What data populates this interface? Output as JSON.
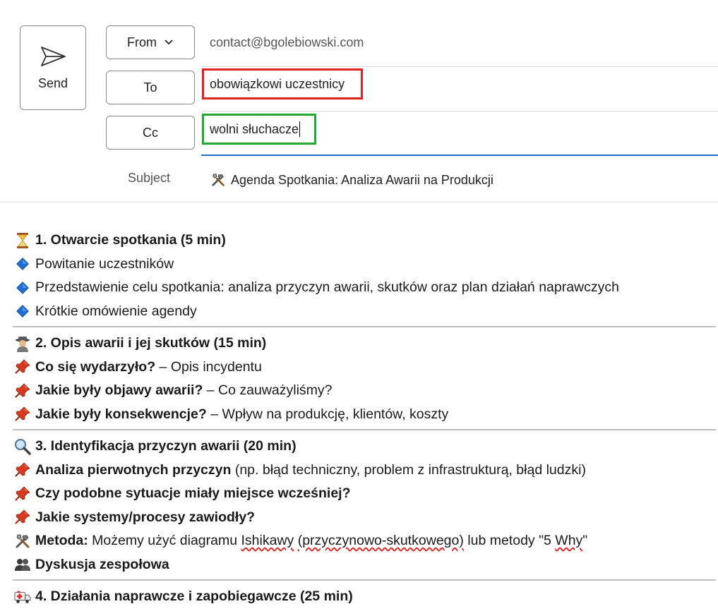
{
  "header": {
    "send_label": "Send",
    "from_label": "From",
    "from_value": "contact@bgolebiowski.com",
    "to_label": "To",
    "to_value": "obowiązkowi uczestnicy",
    "cc_label": "Cc",
    "cc_value": "wolni słuchacze",
    "subject_label": "Subject",
    "subject_value": "Agenda Spotkania: Analiza Awarii na Produkcji"
  },
  "body": {
    "s1": {
      "title": "1. Otwarcie spotkania (5 min)",
      "items": [
        "Powitanie uczestników",
        "Przedstawienie celu spotkania: analiza przyczyn awarii, skutków oraz plan działań naprawczych",
        "Krótkie omówienie agendy"
      ]
    },
    "s2": {
      "title": "2. Opis awarii i jej skutków (15 min)",
      "items": [
        {
          "bold": "Co się wydarzyło?",
          "rest": " – Opis incydentu"
        },
        {
          "bold": "Jakie były objawy awarii?",
          "rest": " – Co zauważyliśmy?"
        },
        {
          "bold": "Jakie były konsekwencje?",
          "rest": " – Wpływ na produkcję, klientów, koszty"
        }
      ]
    },
    "s3": {
      "title": "3. Identyfikacja przyczyn awarii (20 min)",
      "item1_bold": "Analiza pierwotnych przyczyn",
      "item1_rest": " (np. błąd techniczny, problem z infrastrukturą, błąd ludzki)",
      "item2_bold": "Czy podobne sytuacje miały miejsce wcześniej?",
      "item3_bold": "Jakie systemy/procesy zawiodły?",
      "metoda_bold": "Metoda:",
      "metoda_t1": " Możemy użyć diagramu ",
      "metoda_ishikawa": "Ishikawy",
      "metoda_t2": " ",
      "metoda_paren": "(przyczynowo-skutkowego)",
      "metoda_t3": " lub metody \"5 ",
      "metoda_why": "Why",
      "metoda_t4": "\"",
      "dyskusja_bold": "Dyskusja zespołowa"
    },
    "s4": {
      "title": "4. Działania naprawcze i zapobiegawcze (25 min)"
    }
  },
  "icons": {
    "send": "send-icon",
    "hourglass": "hourglass-icon",
    "diamond": "blue-diamond-icon",
    "detective": "detective-icon",
    "pin": "pushpin-icon",
    "magnifier": "magnifier-icon",
    "tools": "hammer-wrench-icon",
    "people": "people-icon",
    "ambulance": "ambulance-icon"
  },
  "colors": {
    "to_highlight": "#e02020",
    "cc_highlight": "#22a833",
    "active_underline": "#2b6cc4",
    "diamond_blue": "#1f6fd1",
    "pin_red": "#d83a1f"
  }
}
